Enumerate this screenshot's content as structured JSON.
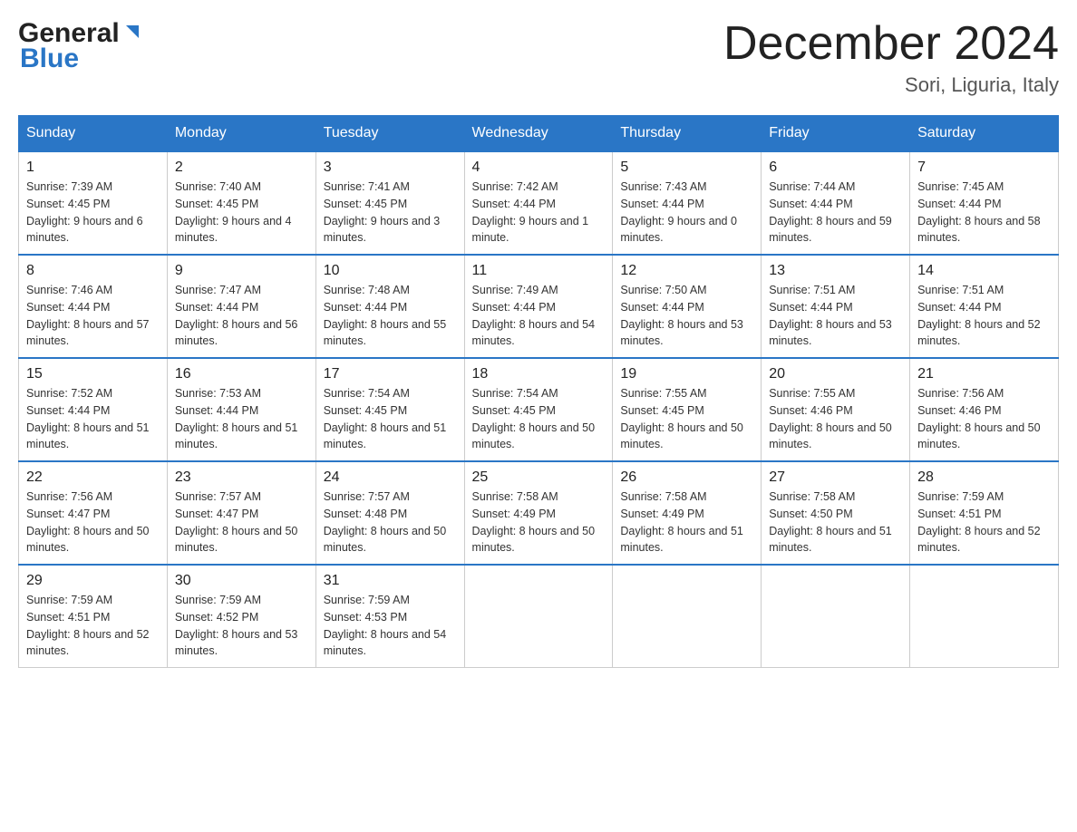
{
  "header": {
    "title": "December 2024",
    "subtitle": "Sori, Liguria, Italy",
    "logo_general": "General",
    "logo_blue": "Blue"
  },
  "days_of_week": [
    "Sunday",
    "Monday",
    "Tuesday",
    "Wednesday",
    "Thursday",
    "Friday",
    "Saturday"
  ],
  "weeks": [
    [
      {
        "date": "1",
        "sunrise": "7:39 AM",
        "sunset": "4:45 PM",
        "daylight": "9 hours and 6 minutes."
      },
      {
        "date": "2",
        "sunrise": "7:40 AM",
        "sunset": "4:45 PM",
        "daylight": "9 hours and 4 minutes."
      },
      {
        "date": "3",
        "sunrise": "7:41 AM",
        "sunset": "4:45 PM",
        "daylight": "9 hours and 3 minutes."
      },
      {
        "date": "4",
        "sunrise": "7:42 AM",
        "sunset": "4:44 PM",
        "daylight": "9 hours and 1 minute."
      },
      {
        "date": "5",
        "sunrise": "7:43 AM",
        "sunset": "4:44 PM",
        "daylight": "9 hours and 0 minutes."
      },
      {
        "date": "6",
        "sunrise": "7:44 AM",
        "sunset": "4:44 PM",
        "daylight": "8 hours and 59 minutes."
      },
      {
        "date": "7",
        "sunrise": "7:45 AM",
        "sunset": "4:44 PM",
        "daylight": "8 hours and 58 minutes."
      }
    ],
    [
      {
        "date": "8",
        "sunrise": "7:46 AM",
        "sunset": "4:44 PM",
        "daylight": "8 hours and 57 minutes."
      },
      {
        "date": "9",
        "sunrise": "7:47 AM",
        "sunset": "4:44 PM",
        "daylight": "8 hours and 56 minutes."
      },
      {
        "date": "10",
        "sunrise": "7:48 AM",
        "sunset": "4:44 PM",
        "daylight": "8 hours and 55 minutes."
      },
      {
        "date": "11",
        "sunrise": "7:49 AM",
        "sunset": "4:44 PM",
        "daylight": "8 hours and 54 minutes."
      },
      {
        "date": "12",
        "sunrise": "7:50 AM",
        "sunset": "4:44 PM",
        "daylight": "8 hours and 53 minutes."
      },
      {
        "date": "13",
        "sunrise": "7:51 AM",
        "sunset": "4:44 PM",
        "daylight": "8 hours and 53 minutes."
      },
      {
        "date": "14",
        "sunrise": "7:51 AM",
        "sunset": "4:44 PM",
        "daylight": "8 hours and 52 minutes."
      }
    ],
    [
      {
        "date": "15",
        "sunrise": "7:52 AM",
        "sunset": "4:44 PM",
        "daylight": "8 hours and 51 minutes."
      },
      {
        "date": "16",
        "sunrise": "7:53 AM",
        "sunset": "4:44 PM",
        "daylight": "8 hours and 51 minutes."
      },
      {
        "date": "17",
        "sunrise": "7:54 AM",
        "sunset": "4:45 PM",
        "daylight": "8 hours and 51 minutes."
      },
      {
        "date": "18",
        "sunrise": "7:54 AM",
        "sunset": "4:45 PM",
        "daylight": "8 hours and 50 minutes."
      },
      {
        "date": "19",
        "sunrise": "7:55 AM",
        "sunset": "4:45 PM",
        "daylight": "8 hours and 50 minutes."
      },
      {
        "date": "20",
        "sunrise": "7:55 AM",
        "sunset": "4:46 PM",
        "daylight": "8 hours and 50 minutes."
      },
      {
        "date": "21",
        "sunrise": "7:56 AM",
        "sunset": "4:46 PM",
        "daylight": "8 hours and 50 minutes."
      }
    ],
    [
      {
        "date": "22",
        "sunrise": "7:56 AM",
        "sunset": "4:47 PM",
        "daylight": "8 hours and 50 minutes."
      },
      {
        "date": "23",
        "sunrise": "7:57 AM",
        "sunset": "4:47 PM",
        "daylight": "8 hours and 50 minutes."
      },
      {
        "date": "24",
        "sunrise": "7:57 AM",
        "sunset": "4:48 PM",
        "daylight": "8 hours and 50 minutes."
      },
      {
        "date": "25",
        "sunrise": "7:58 AM",
        "sunset": "4:49 PM",
        "daylight": "8 hours and 50 minutes."
      },
      {
        "date": "26",
        "sunrise": "7:58 AM",
        "sunset": "4:49 PM",
        "daylight": "8 hours and 51 minutes."
      },
      {
        "date": "27",
        "sunrise": "7:58 AM",
        "sunset": "4:50 PM",
        "daylight": "8 hours and 51 minutes."
      },
      {
        "date": "28",
        "sunrise": "7:59 AM",
        "sunset": "4:51 PM",
        "daylight": "8 hours and 52 minutes."
      }
    ],
    [
      {
        "date": "29",
        "sunrise": "7:59 AM",
        "sunset": "4:51 PM",
        "daylight": "8 hours and 52 minutes."
      },
      {
        "date": "30",
        "sunrise": "7:59 AM",
        "sunset": "4:52 PM",
        "daylight": "8 hours and 53 minutes."
      },
      {
        "date": "31",
        "sunrise": "7:59 AM",
        "sunset": "4:53 PM",
        "daylight": "8 hours and 54 minutes."
      },
      null,
      null,
      null,
      null
    ]
  ]
}
